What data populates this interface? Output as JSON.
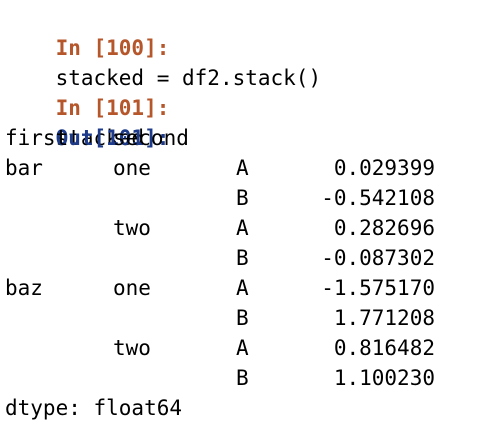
{
  "cells": [
    {
      "in_prompt": "In [100]:",
      "code": "stacked = df2.stack()"
    },
    {
      "in_prompt": "In [101]:",
      "code": "stacked",
      "out_prompt": "Out[101]:"
    }
  ],
  "output": {
    "index_names": [
      "first",
      "second"
    ],
    "rows": [
      {
        "first": "bar",
        "second": "one",
        "col": "A",
        "value": "0.029399"
      },
      {
        "first": "",
        "second": "",
        "col": "B",
        "value": "-0.542108"
      },
      {
        "first": "",
        "second": "two",
        "col": "A",
        "value": "0.282696"
      },
      {
        "first": "",
        "second": "",
        "col": "B",
        "value": "-0.087302"
      },
      {
        "first": "baz",
        "second": "one",
        "col": "A",
        "value": "-1.575170"
      },
      {
        "first": "",
        "second": "",
        "col": "B",
        "value": "1.771208"
      },
      {
        "first": "",
        "second": "two",
        "col": "A",
        "value": "0.816482"
      },
      {
        "first": "",
        "second": "",
        "col": "B",
        "value": "1.100230"
      }
    ],
    "dtype": "dtype: float64"
  },
  "colors": {
    "in_prompt": "#b5562b",
    "out_prompt": "#1d3b8a",
    "text": "#000000",
    "background": "#ffffff"
  }
}
